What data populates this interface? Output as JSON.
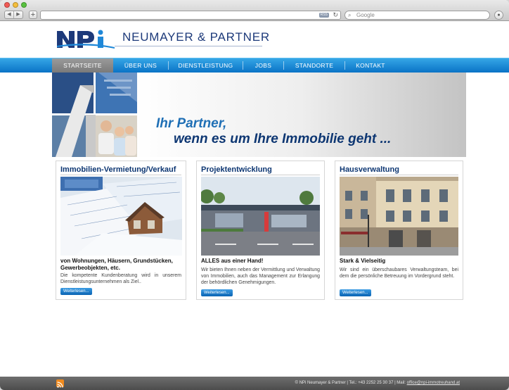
{
  "browser": {
    "nav_back": "◀",
    "nav_forward": "▶",
    "new_tab": "+",
    "rss_badge": "RSS",
    "search_placeholder": "Google"
  },
  "brand": {
    "name": "NEUMAYER & PARTNER",
    "logo_text": "NPi",
    "colors": {
      "navy": "#1d3a7a",
      "blue": "#1f88d8"
    }
  },
  "nav": {
    "items": [
      {
        "label": "STARTSEITE",
        "active": true
      },
      {
        "label": "ÜBER UNS",
        "active": false
      },
      {
        "label": "DIENSTLEISTUNG",
        "active": false
      },
      {
        "label": "JOBS",
        "active": false
      },
      {
        "label": "STANDORTE",
        "active": false
      },
      {
        "label": "KONTAKT",
        "active": false
      }
    ]
  },
  "hero": {
    "line1": "Ihr Partner,",
    "line2": "wenn es um Ihre Immobilie geht ..."
  },
  "cards": [
    {
      "title": "Immobilien-Vermietung/Verkauf",
      "subtitle": "von Wohnungen, Häusern, Grundstücken, Gewerbeobjekten, etc.",
      "text": "Die kompetente Kundenberatung wird in unserem Dienstleistungsunternehmen als Ziel..",
      "button": "Weiterlesen..."
    },
    {
      "title": "Projektentwicklung",
      "subtitle": "ALLES aus einer Hand!",
      "text": "Wir bieten Ihnen neben der Vermittlung und Verwaltung von Immobilien, auch das Management zur Erlangung der behördlichen Genehmigungen.",
      "button": "Weiterlesen..."
    },
    {
      "title": "Hausverwaltung",
      "subtitle": "Stark & Vielseitig",
      "text": "Wir sind ein überschaubares Verwaltungsteam, bei dem die persönliche Betreuung im Vordergrund steht.",
      "button": "Weiterlesen..."
    }
  ],
  "footer": {
    "text": "© NPi Neumayer & Partner | Tel.: +43 2252 25 30 37 | Mail: ",
    "email": "office@npi-immotreuhand.at"
  }
}
